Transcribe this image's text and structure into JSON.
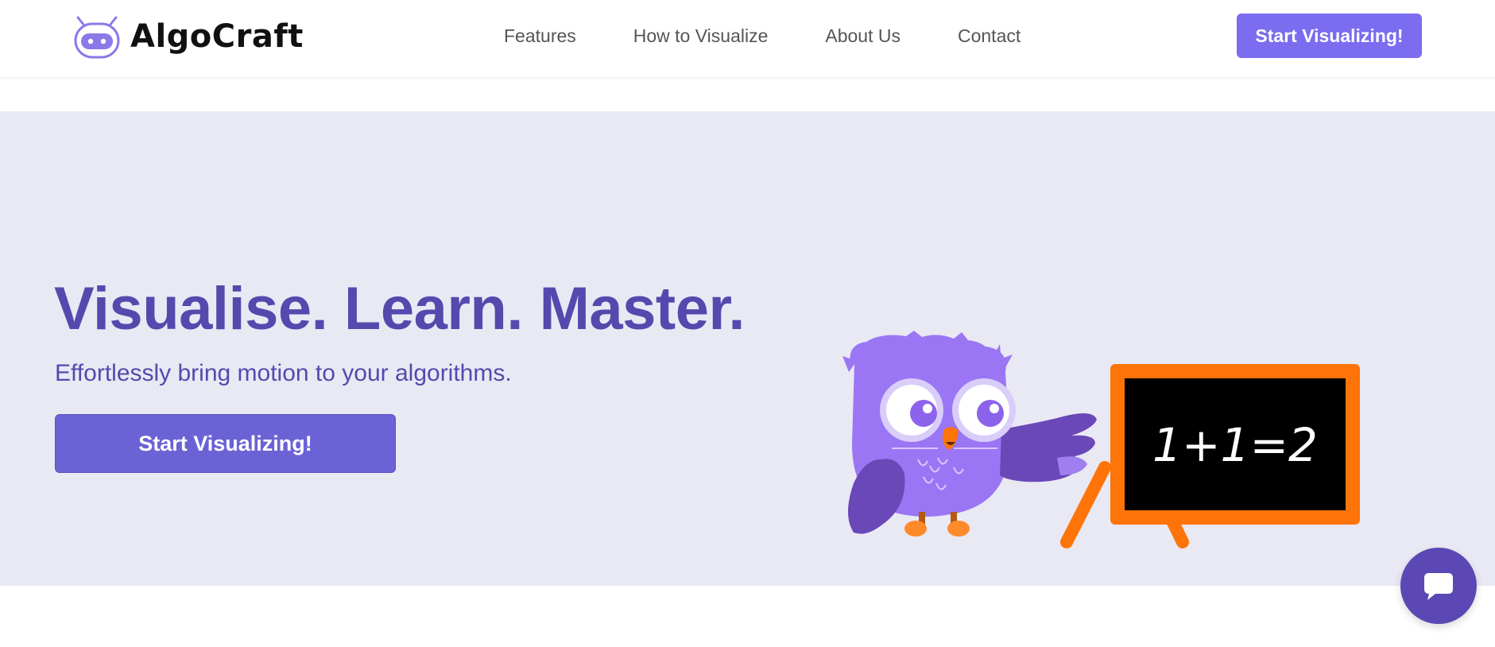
{
  "brand": {
    "name": "AlgoCraft",
    "logo_icon": "robot-icon"
  },
  "nav": {
    "links": [
      "Features",
      "How to Visualize",
      "About Us",
      "Contact"
    ],
    "cta_label": "Start Visualizing!"
  },
  "hero": {
    "title": "Visualise. Learn. Master.",
    "subtitle": "Effortlessly bring motion to your algorithms.",
    "cta_label": "Start Visualizing!",
    "illustration": {
      "character": "owl-icon",
      "chalkboard_text": "1+1=2"
    }
  },
  "chat": {
    "icon": "chat-bubble-icon"
  },
  "colors": {
    "accent": "#7b6cf0",
    "hero_bg": "#e9e9f4",
    "title": "#5549ae",
    "hero_button": "#6b62d6",
    "chalkboard_frame": "#ff7409",
    "owl_body": "#9b76f4",
    "chat_fab": "#5b48b4"
  }
}
